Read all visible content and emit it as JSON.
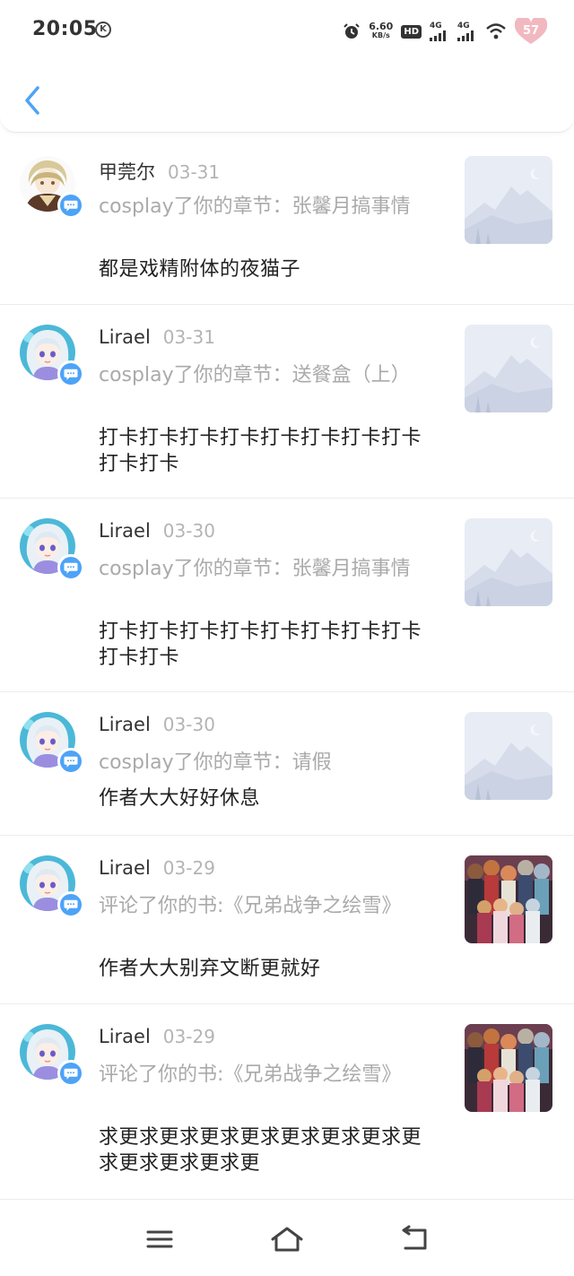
{
  "status_bar": {
    "time": "20:05",
    "k_badge": "K",
    "net_speed": "6.60",
    "net_unit": "KB/s",
    "hd": "HD",
    "sig1": "4G",
    "sig2": "4G",
    "battery": "57"
  },
  "colors": {
    "accent": "#4da3f7",
    "muted_text": "#aaaaaa",
    "date_text": "#b4b4b4"
  },
  "notifications": [
    {
      "user": "甲莞尔",
      "date": "03-31",
      "action": "cosplay了你的章节：张馨月搞事情",
      "comment": "都是戏精附体的夜猫子",
      "avatar": "avatar-1",
      "thumb": "placeholder"
    },
    {
      "user": "Lirael",
      "date": "03-31",
      "action": "cosplay了你的章节：送餐盒（上）",
      "comment": "打卡打卡打卡打卡打卡打卡打卡打卡打卡打卡",
      "avatar": "avatar-2",
      "thumb": "placeholder"
    },
    {
      "user": "Lirael",
      "date": "03-30",
      "action": "cosplay了你的章节：张馨月搞事情",
      "comment": "打卡打卡打卡打卡打卡打卡打卡打卡打卡打卡",
      "avatar": "avatar-2",
      "thumb": "placeholder"
    },
    {
      "user": "Lirael",
      "date": "03-30",
      "action": "cosplay了你的章节：请假",
      "comment": "作者大大好好休息",
      "avatar": "avatar-2",
      "thumb": "placeholder"
    },
    {
      "user": "Lirael",
      "date": "03-29",
      "action": "评论了你的书:《兄弟战争之绘雪》",
      "comment": "作者大大别弃文断更就好",
      "avatar": "avatar-2",
      "thumb": "book-cover"
    },
    {
      "user": "Lirael",
      "date": "03-29",
      "action": "评论了你的书:《兄弟战争之绘雪》",
      "comment": "求更求更求更求更求更求更求更求更求更求更求更求更",
      "avatar": "avatar-2",
      "thumb": "book-cover"
    }
  ],
  "nav": {
    "menu": "menu-icon",
    "home": "home-icon",
    "back": "back-icon"
  }
}
